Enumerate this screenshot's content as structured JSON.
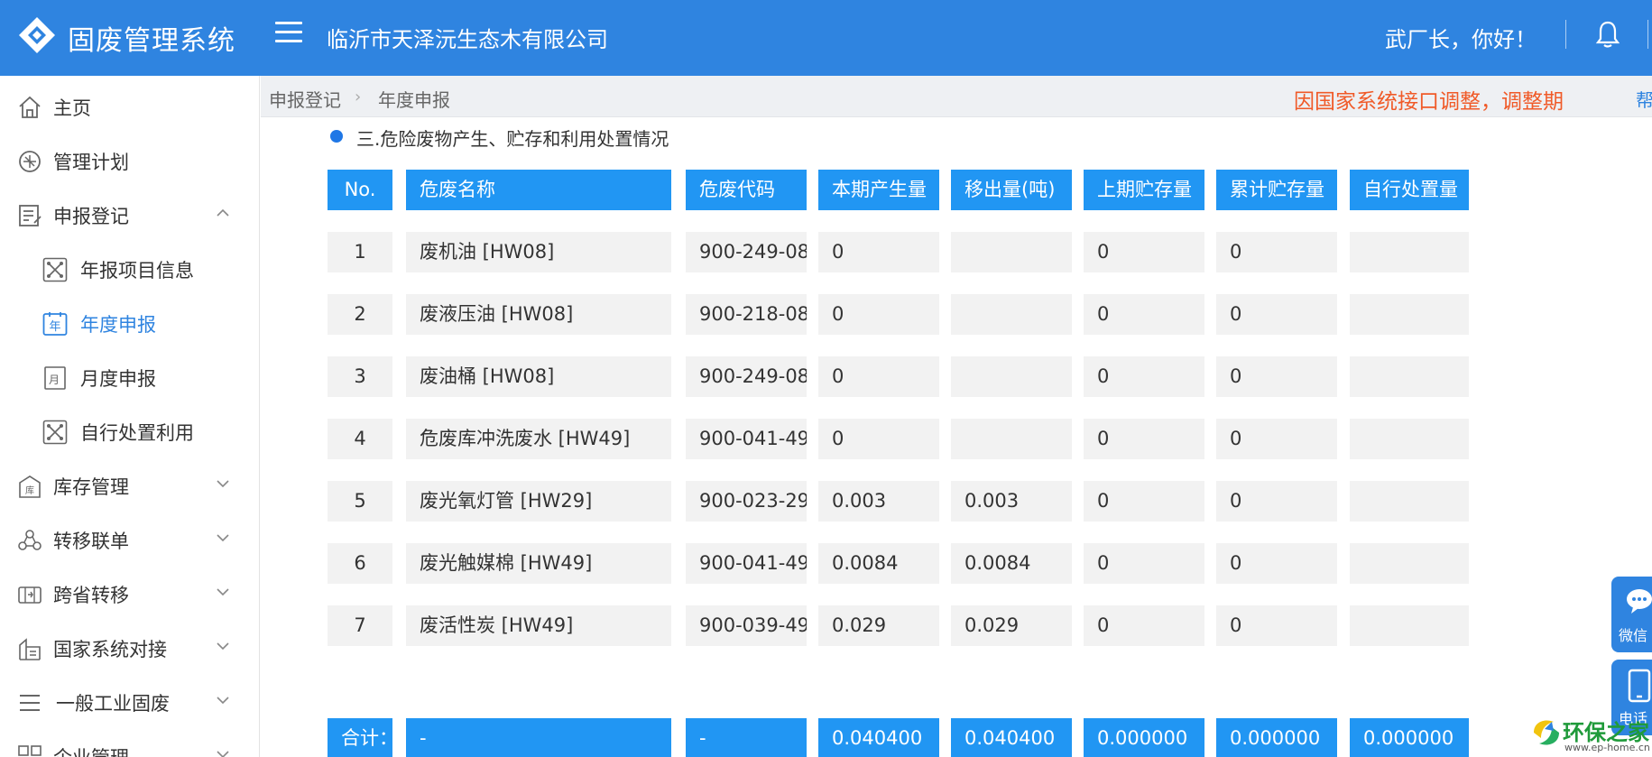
{
  "header": {
    "app_title": "固废管理系统",
    "company_name": "临沂市天泽沅生态木有限公司",
    "greeting": "武厂长，你好！"
  },
  "sidebar": {
    "items": [
      {
        "label": "主页",
        "icon": "home-icon"
      },
      {
        "label": "管理计划",
        "icon": "plan-icon"
      },
      {
        "label": "申报登记",
        "icon": "register-icon",
        "expanded": true
      },
      {
        "label": "年报项目信息",
        "icon": "network-icon"
      },
      {
        "label": "年度申报",
        "icon": "calendar-year-icon",
        "active": true
      },
      {
        "label": "月度申报",
        "icon": "calendar-month-icon"
      },
      {
        "label": "自行处置利用",
        "icon": "network-icon"
      },
      {
        "label": "库存管理",
        "icon": "warehouse-icon"
      },
      {
        "label": "转移联单",
        "icon": "transfer-icon"
      },
      {
        "label": "跨省转移",
        "icon": "cross-province-icon"
      },
      {
        "label": "国家系统对接",
        "icon": "national-system-icon"
      },
      {
        "label": "一般工业固废",
        "icon": "list-icon"
      },
      {
        "label": "企业管理",
        "icon": "grid-icon"
      }
    ]
  },
  "breadcrumb": {
    "items": [
      "申报登记",
      "年度申报"
    ],
    "notice": "因国家系统接口调整，调整期",
    "help": "帮"
  },
  "section": {
    "title": "三.危险废物产生、贮存和利用处置情况"
  },
  "table": {
    "headers": [
      "No.",
      "危废名称",
      "危废代码",
      "本期产生量",
      "移出量(吨)",
      "上期贮存量",
      "累计贮存量",
      "自行处置量"
    ],
    "rows": [
      [
        "1",
        "废机油 [HW08]",
        "900-249-08",
        "0",
        "",
        "0",
        "0",
        ""
      ],
      [
        "2",
        "废液压油 [HW08]",
        "900-218-08",
        "0",
        "",
        "0",
        "0",
        ""
      ],
      [
        "3",
        "废油桶 [HW08]",
        "900-249-08",
        "0",
        "",
        "0",
        "0",
        ""
      ],
      [
        "4",
        "危废库冲洗废水 [HW49]",
        "900-041-49",
        "0",
        "",
        "0",
        "0",
        ""
      ],
      [
        "5",
        "废光氧灯管 [HW29]",
        "900-023-29",
        "0.003",
        "0.003",
        "0",
        "0",
        ""
      ],
      [
        "6",
        "废光触媒棉 [HW49]",
        "900-041-49",
        "0.0084",
        "0.0084",
        "0",
        "0",
        ""
      ],
      [
        "7",
        "废活性炭 [HW49]",
        "900-039-49",
        "0.029",
        "0.029",
        "0",
        "0",
        ""
      ]
    ],
    "footer": [
      "合计：",
      "-",
      "-",
      "0.040400",
      "0.040400",
      "0.000000",
      "0.000000",
      "0.000000"
    ]
  },
  "float_buttons": [
    {
      "label": "微信",
      "icon": "chat-icon"
    },
    {
      "label": "电话",
      "icon": "phone-icon"
    }
  ],
  "watermark": {
    "text": "环保之家",
    "url": "www.ep-home.cn"
  },
  "colors": {
    "header_bg": "#2f84e0",
    "table_header_bg": "#2196f3",
    "cell_bg": "#f2f2f2",
    "active_text": "#2f84e0",
    "notice_text": "#f05a28"
  }
}
